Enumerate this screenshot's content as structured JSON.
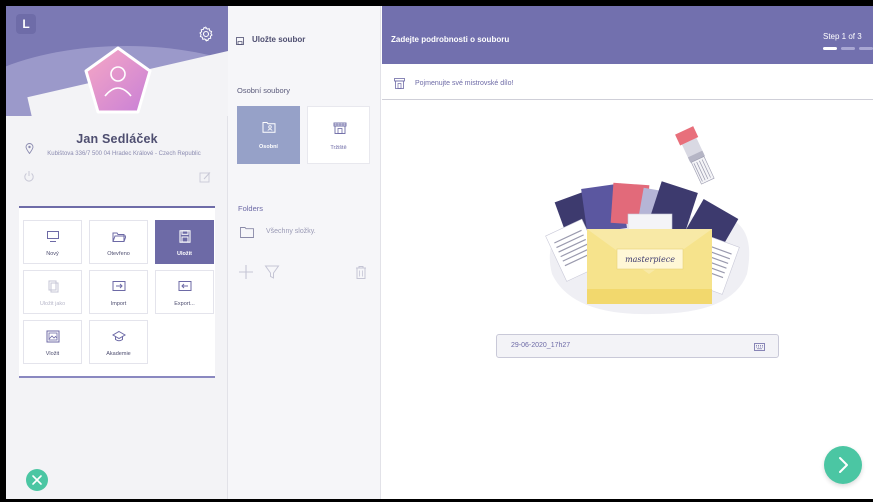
{
  "app": {
    "logo_letter": "L"
  },
  "profile": {
    "name": "Jan Sedláček",
    "address": "Kubištova 336/7 500 04 Hradec Králové - Czech Republic"
  },
  "menu": {
    "items": [
      {
        "label": "Nový",
        "icon": "monitor-icon",
        "state": "normal"
      },
      {
        "label": "Otevřeno",
        "icon": "folder-open-icon",
        "state": "normal"
      },
      {
        "label": "Uložit",
        "icon": "floppy-icon",
        "state": "active"
      },
      {
        "label": "Uložit jako",
        "icon": "copy-icon",
        "state": "disabled"
      },
      {
        "label": "Import",
        "icon": "import-icon",
        "state": "normal"
      },
      {
        "label": "Export...",
        "icon": "export-icon",
        "state": "normal"
      },
      {
        "label": "Vložit",
        "icon": "image-icon",
        "state": "normal"
      },
      {
        "label": "Akademie",
        "icon": "graduation-cap-icon",
        "state": "normal"
      }
    ]
  },
  "save_panel": {
    "title": "Uložte soubor",
    "personal_files_label": "Osobní soubory",
    "sources": [
      {
        "label": "Osobní",
        "icon": "personal-folder-icon",
        "selected": true
      },
      {
        "label": "Tržiště",
        "icon": "market-icon",
        "selected": false
      }
    ],
    "folders_label": "Folders",
    "all_folders_label": "Všechny složky."
  },
  "main": {
    "title": "Zadejte podrobnosti o souboru",
    "step_text": "Step 1 of 3",
    "name_prompt": "Pojmenujte své mistrovské dílo!",
    "envelope_text": "masterpiece",
    "filename_value": "29-06-2020_17h27"
  },
  "colors": {
    "brand": "#7270ae",
    "accent": "#4bc6a3",
    "active_tile": "#6d6aa6",
    "personal_tile": "#96a1c8"
  }
}
